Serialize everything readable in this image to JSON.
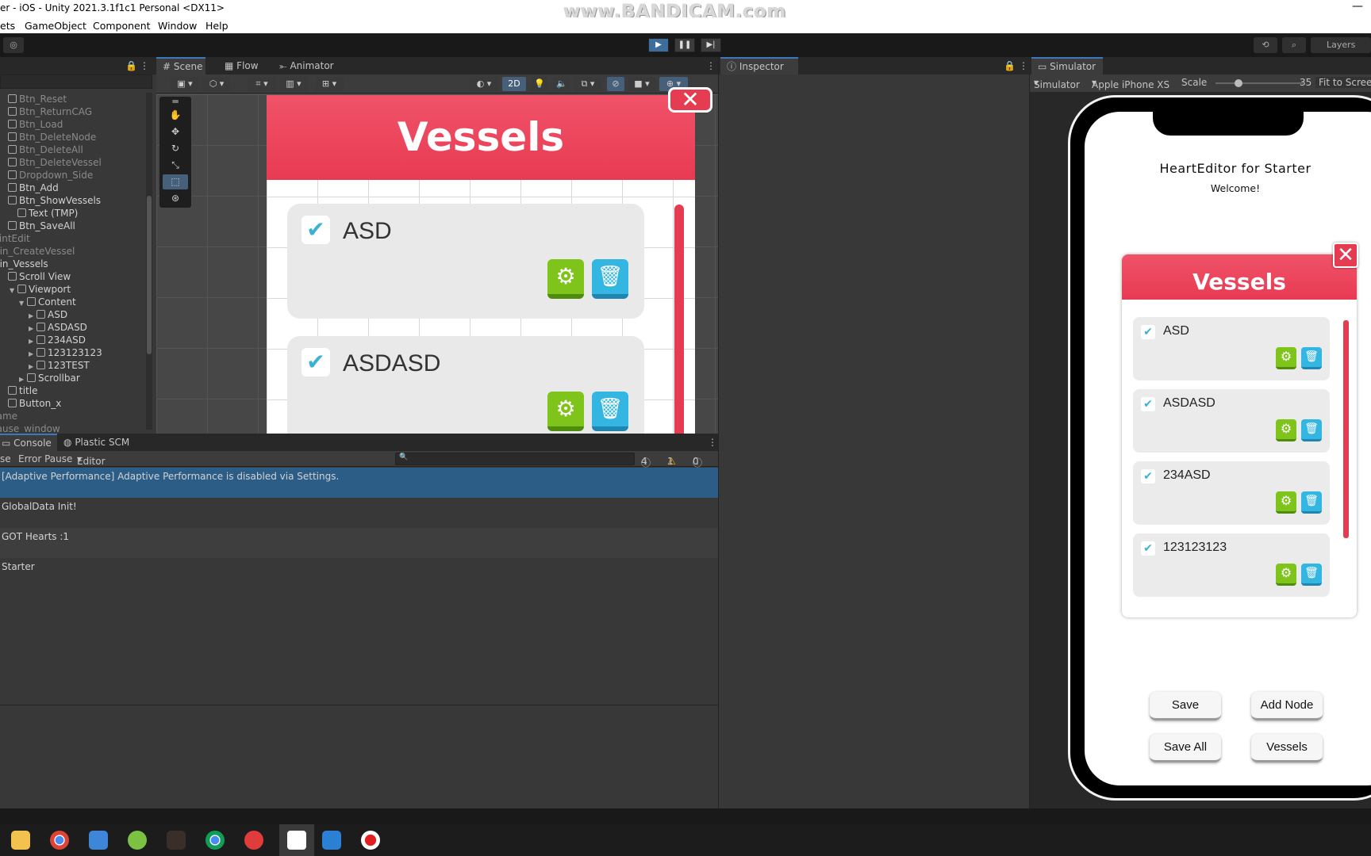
{
  "window": {
    "title": "er - iOS - Unity 2021.3.1f1c1 Personal <DX11>",
    "watermark": "www.BANDICAM.com",
    "minimize": "—"
  },
  "menu": [
    "ets",
    "GameObject",
    "Component",
    "Window",
    "Help"
  ],
  "toolbar": {
    "play": "▶",
    "pause": "❚❚",
    "step": "▶|",
    "history": "⟲",
    "search": "⌕",
    "layers": "Layers"
  },
  "hierarchy": {
    "items": [
      {
        "label": "Btn_Reset",
        "dim": true,
        "indent": 0,
        "arrow": ""
      },
      {
        "label": "Btn_ReturnCAG",
        "dim": true,
        "indent": 0,
        "arrow": ""
      },
      {
        "label": "Btn_Load",
        "dim": true,
        "indent": 0,
        "arrow": ""
      },
      {
        "label": "Btn_DeleteNode",
        "dim": true,
        "indent": 0,
        "arrow": ""
      },
      {
        "label": "Btn_DeleteAll",
        "dim": true,
        "indent": 0,
        "arrow": ""
      },
      {
        "label": "Btn_DeleteVessel",
        "dim": true,
        "indent": 0,
        "arrow": ""
      },
      {
        "label": "Dropdown_Side",
        "dim": true,
        "indent": 0,
        "arrow": ""
      },
      {
        "label": "Btn_Add",
        "dim": false,
        "indent": 0,
        "arrow": ""
      },
      {
        "label": "Btn_ShowVessels",
        "dim": false,
        "indent": 0,
        "arrow": ""
      },
      {
        "label": "Text (TMP)",
        "dim": false,
        "indent": 1,
        "arrow": ""
      },
      {
        "label": "Btn_SaveAll",
        "dim": false,
        "indent": 0,
        "arrow": ""
      },
      {
        "label": "JointEdit",
        "dim": true,
        "indent": -1,
        "arrow": ""
      },
      {
        "label": "Win_CreateVessel",
        "dim": true,
        "indent": -1,
        "arrow": ""
      },
      {
        "label": "Win_Vessels",
        "dim": false,
        "indent": -1,
        "arrow": ""
      },
      {
        "label": "Scroll View",
        "dim": false,
        "indent": 0,
        "arrow": ""
      },
      {
        "label": "Viewport",
        "dim": false,
        "indent": 1,
        "arrow": "▼"
      },
      {
        "label": "Content",
        "dim": false,
        "indent": 2,
        "arrow": "▼"
      },
      {
        "label": "ASD",
        "dim": false,
        "indent": 3,
        "arrow": "▶"
      },
      {
        "label": "ASDASD",
        "dim": false,
        "indent": 3,
        "arrow": "▶"
      },
      {
        "label": "234ASD",
        "dim": false,
        "indent": 3,
        "arrow": "▶"
      },
      {
        "label": "123123123",
        "dim": false,
        "indent": 3,
        "arrow": "▶"
      },
      {
        "label": "123TEST",
        "dim": false,
        "indent": 3,
        "arrow": "▶"
      },
      {
        "label": "Scrollbar",
        "dim": false,
        "indent": 2,
        "arrow": "▶"
      },
      {
        "label": "title",
        "dim": false,
        "indent": 0,
        "arrow": ""
      },
      {
        "label": "Button_x",
        "dim": false,
        "indent": 0,
        "arrow": ""
      },
      {
        "label": "game",
        "dim": true,
        "indent": -1,
        "arrow": ""
      },
      {
        "label": "pause_window",
        "dim": true,
        "indent": -1,
        "arrow": ""
      }
    ]
  },
  "scene": {
    "tabs": [
      "Scene",
      "Flow",
      "Animator"
    ],
    "mode2d": "2D",
    "panel_title": "Vessels",
    "items": [
      "ASD",
      "ASDASD"
    ],
    "close": "✕",
    "check": "✔",
    "gear": "⚙",
    "trash": "🗑"
  },
  "console": {
    "tabs": [
      "Console",
      "Plastic SCM"
    ],
    "bar": {
      "clear": "se",
      "error_pause": "Error Pause",
      "editor": "Editor",
      "count_log": "4",
      "count_warn": "1",
      "count_err": "0",
      "search_placeholder": "🔍"
    },
    "rows": [
      "[Adaptive Performance] Adaptive Performance is disabled via Settings.",
      "GlobalData Init!",
      "GOT Hearts :1",
      "Starter"
    ]
  },
  "inspector": {
    "tab": "Inspector"
  },
  "simulator": {
    "tab": "Simulator",
    "mode": "Simulator",
    "device": "Apple iPhone XS",
    "scale_label": "Scale",
    "scale_value": "35",
    "fit": "Fit to Scree",
    "scale_pct": 0.22,
    "app_title": "HeartEditor for Starter",
    "welcome": "Welcome!",
    "panel_title": "Vessels",
    "items": [
      "ASD",
      "ASDASD",
      "234ASD",
      "123123123"
    ],
    "buttons": {
      "save": "Save",
      "add_node": "Add Node",
      "save_all": "Save All",
      "vessels": "Vessels"
    }
  },
  "taskbar": {
    "apps": [
      "file-explorer-icon",
      "chrome-icon",
      "notepad-icon",
      "app-green-icon",
      "app-dark-icon",
      "chrome-icon",
      "netease-music-icon",
      "unity-icon",
      "vscode-icon",
      "bandicam-record-icon"
    ]
  }
}
